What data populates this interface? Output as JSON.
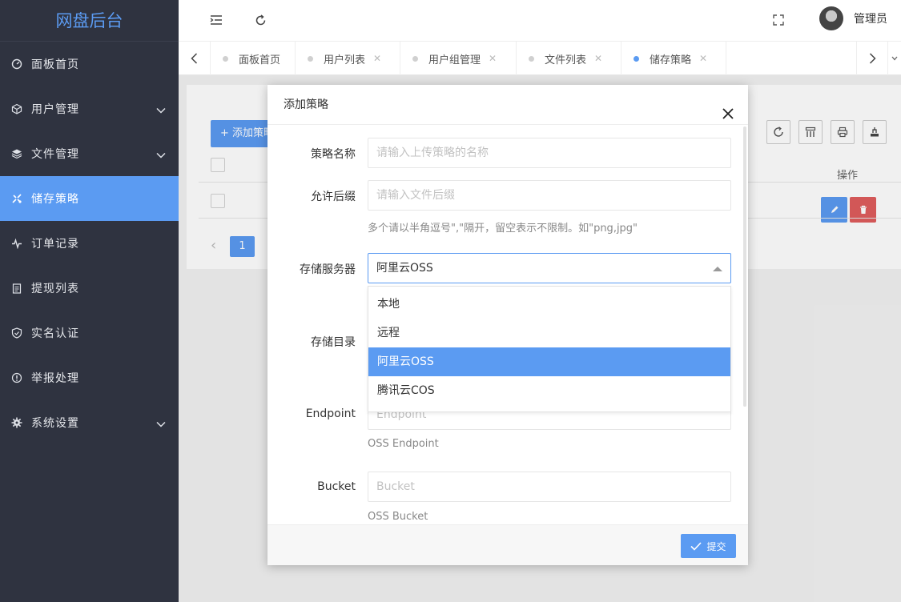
{
  "app": {
    "title": "网盘后台"
  },
  "sidebar": {
    "items": [
      {
        "label": "面板首页",
        "icon": "dashboard-icon"
      },
      {
        "label": "用户管理",
        "icon": "cube-icon"
      },
      {
        "label": "文件管理",
        "icon": "layers-icon"
      },
      {
        "label": "储存策略",
        "icon": "storage-icon",
        "active": true
      },
      {
        "label": "订单记录",
        "icon": "pulse-icon"
      },
      {
        "label": "提现列表",
        "icon": "clipboard-icon"
      },
      {
        "label": "实名认证",
        "icon": "shield-icon"
      },
      {
        "label": "举报处理",
        "icon": "alert-icon"
      },
      {
        "label": "系统设置",
        "icon": "gear-icon"
      }
    ]
  },
  "header": {
    "user_name": "管理员"
  },
  "tabs": [
    {
      "label": "面板首页"
    },
    {
      "label": "用户列表"
    },
    {
      "label": "用户组管理"
    },
    {
      "label": "文件列表"
    },
    {
      "label": "储存策略",
      "active": true
    }
  ],
  "toolbar": {
    "add_label": "+ 添加策略"
  },
  "table": {
    "ops_header": "操作"
  },
  "pagination": {
    "current": "1"
  },
  "modal": {
    "title": "添加策略",
    "name_label": "策略名称",
    "name_placeholder": "请输入上传策略的名称",
    "ext_label": "允许后缀",
    "ext_placeholder": "请输入文件后缀",
    "ext_help": "多个请以半角逗号\",\"隔开，留空表示不限制。如\"png,jpg\"",
    "server_label": "存储服务器",
    "server_value": "阿里云OSS",
    "server_options": [
      "本地",
      "远程",
      "阿里云OSS",
      "腾讯云COS"
    ],
    "dir_label": "存储目录",
    "endpoint_label": "Endpoint",
    "endpoint_placeholder": "Endpoint",
    "endpoint_help": "OSS Endpoint",
    "bucket_label": "Bucket",
    "bucket_placeholder": "Bucket",
    "bucket_help": "OSS Bucket",
    "submit_label": "提交"
  },
  "colors": {
    "accent": "#5b9bf2",
    "sidebar_bg": "#2f3340",
    "danger": "#e05d5d"
  }
}
